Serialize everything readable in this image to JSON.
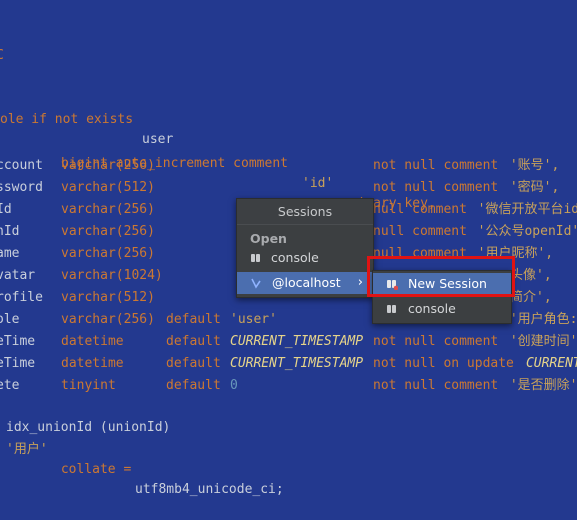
{
  "code": {
    "line0": "C",
    "line1": {
      "a": "ole if not exists ",
      "b": "user"
    },
    "line2": {
      "type": "bigint auto_increment comment ",
      "str": "'id'",
      "rest": " primary key,"
    },
    "rows": [
      {
        "col": "ccount",
        "type": "varchar(256)",
        "def": "",
        "defv": "",
        "tail": "not null comment ",
        "tstr": "'账号',"
      },
      {
        "col": "ssword",
        "type": "varchar(512)",
        "def": "",
        "defv": "",
        "tail": "not null comment ",
        "tstr": "'密码',"
      },
      {
        "col": "Id",
        "type": "varchar(256)",
        "def": "",
        "defv": "",
        "tail": "null comment ",
        "tstr": "'微信开放平台id"
      },
      {
        "col": "nId",
        "type": "varchar(256)",
        "def": "",
        "defv": "",
        "tail": "null comment ",
        "tstr": "'公众号openId'"
      },
      {
        "col": "ame",
        "type": "varchar(256)",
        "def": "",
        "defv": "",
        "tail": "null comment ",
        "tstr": "'用户昵称',"
      },
      {
        "col": "vatar",
        "type": "varchar(1024)",
        "def": "",
        "defv": "",
        "tail": "",
        "tstr": "头像',"
      },
      {
        "col": "rofile",
        "type": "varchar(512)",
        "def": "",
        "defv": "",
        "tail": "",
        "tstr": "简介',"
      },
      {
        "col": "ole",
        "type": "varchar(256)",
        "def": "default ",
        "defv": "'user'",
        "tail": "not null comment ",
        "tstr": "'用户角色:"
      },
      {
        "col": "eTime",
        "type": "datetime",
        "def": "default ",
        "defv": "CURRENT_TIMESTAMP",
        "tail": "not null comment ",
        "tstr": "'创建时间'"
      },
      {
        "col": "eTime",
        "type": "datetime",
        "def": "default ",
        "defv": "CURRENT_TIMESTAMP",
        "tail": "not null on update ",
        "tstr": "CURRENT"
      },
      {
        "col": "ete",
        "type": "tinyint",
        "def": "default ",
        "defv": "0",
        "tail": "not null comment ",
        "tstr": "'是否删除'"
      }
    ],
    "index_line": "idx_unionId (unionId)",
    "last_line": {
      "str": "'用户'",
      "a": " collate = ",
      "b": "utf8mb4_unicode_ci;"
    }
  },
  "sessions_popup": {
    "title": "Sessions",
    "group_open": "Open",
    "item_console": "console",
    "item_localhost": "@localhost",
    "arrow": "›"
  },
  "submenu": {
    "new_session": "New Session",
    "console": "console"
  },
  "colors": {
    "background": "#23398f",
    "keyword": "#cc7832",
    "string": "#c8a15a",
    "selection": "#4b6eaf",
    "highlight_box": "#e01313"
  }
}
